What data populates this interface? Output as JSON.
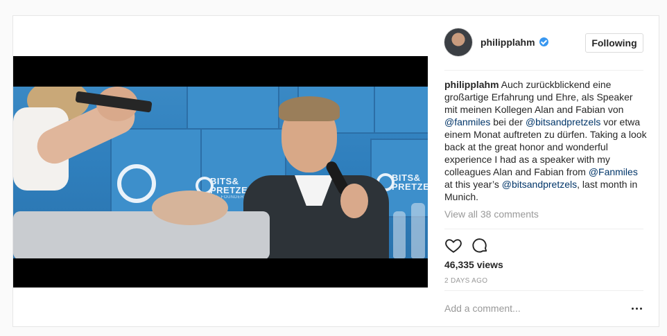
{
  "post": {
    "username": "philipplahm",
    "follow_label": "Following",
    "caption": {
      "user": "philipplahm",
      "parts": [
        {
          "text": " Auch zurückblickend eine großartige Erfahrung und Ehre, als Speaker mit meinen Kollegen Alan and Fabian von "
        },
        {
          "text": "@fanmiles",
          "mention": true
        },
        {
          "text": " bei der "
        },
        {
          "text": "@bitsandpretzels",
          "mention": true
        },
        {
          "text": " vor etwa einem Monat auftreten zu dürfen. Taking a look back at the great honor and wonderful experience I had as a speaker with my colleagues Alan and Fabian from "
        },
        {
          "text": "@Fanmiles",
          "mention": true
        },
        {
          "text": " at this year’s "
        },
        {
          "text": "@bitsandpretzels",
          "mention": true
        },
        {
          "text": ", last month in Munich."
        }
      ]
    },
    "view_all_comments": "View all 38 comments",
    "views": "46,335 views",
    "date": "2 DAYS AGO",
    "comment_placeholder": "Add a comment...",
    "icons": {
      "verified": "verified-badge-icon",
      "like": "heart-icon",
      "comment": "speech-bubble-icon",
      "more": "more-options-icon"
    },
    "colors": {
      "accent": "#3897f0",
      "mention": "#003569",
      "muted": "#999999",
      "text": "#262626"
    }
  },
  "media": {
    "logo_lines": [
      "BITS&",
      "PRETZELS"
    ],
    "logo_tagline": "THE FOUNDERS FESTIVAL"
  }
}
